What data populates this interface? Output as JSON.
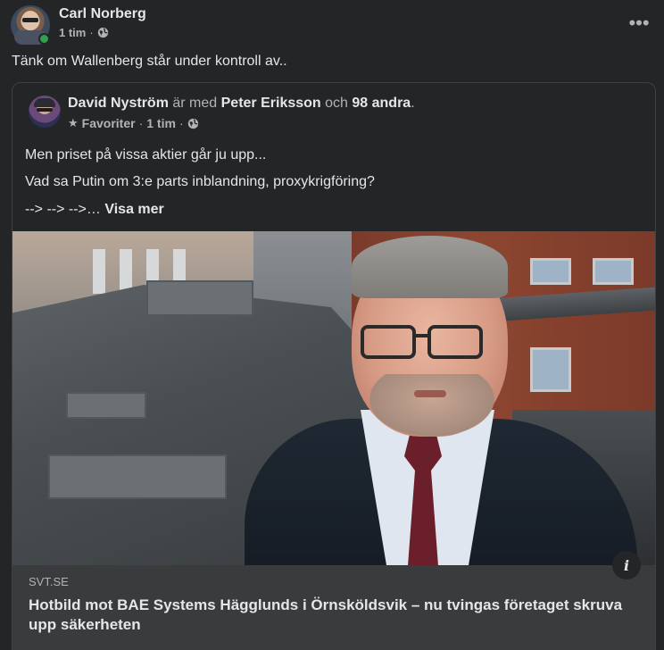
{
  "post": {
    "author": "Carl Norberg",
    "time": "1 tim",
    "separator": "·",
    "text": "Tänk om Wallenberg står under kontroll av..",
    "more_label": "•••",
    "online_color": "#31a24c"
  },
  "shared": {
    "author": "David Nyström",
    "with_text": "är med",
    "tagged": "Peter Eriksson",
    "and_text": "och",
    "others": "98 andra",
    "period": ".",
    "audience": "Favoriter",
    "separator": "·",
    "time": "1 tim",
    "lines": [
      "Men priset på vissa aktier går ju upp...",
      "Vad sa Putin om 3:e parts inblandning, proxykrigföring?",
      "--> --> -->…"
    ],
    "see_more": "Visa mer"
  },
  "link": {
    "domain": "SVT.SE",
    "title": "Hotbild mot BAE Systems Hägglunds i Örnsköldsvik – nu tvingas företaget skruva upp säkerheten",
    "info_label": "i"
  },
  "colors": {
    "background": "#242526",
    "footer": "#3a3b3c",
    "text_primary": "#e4e6eb",
    "text_secondary": "#b0b3b8"
  }
}
